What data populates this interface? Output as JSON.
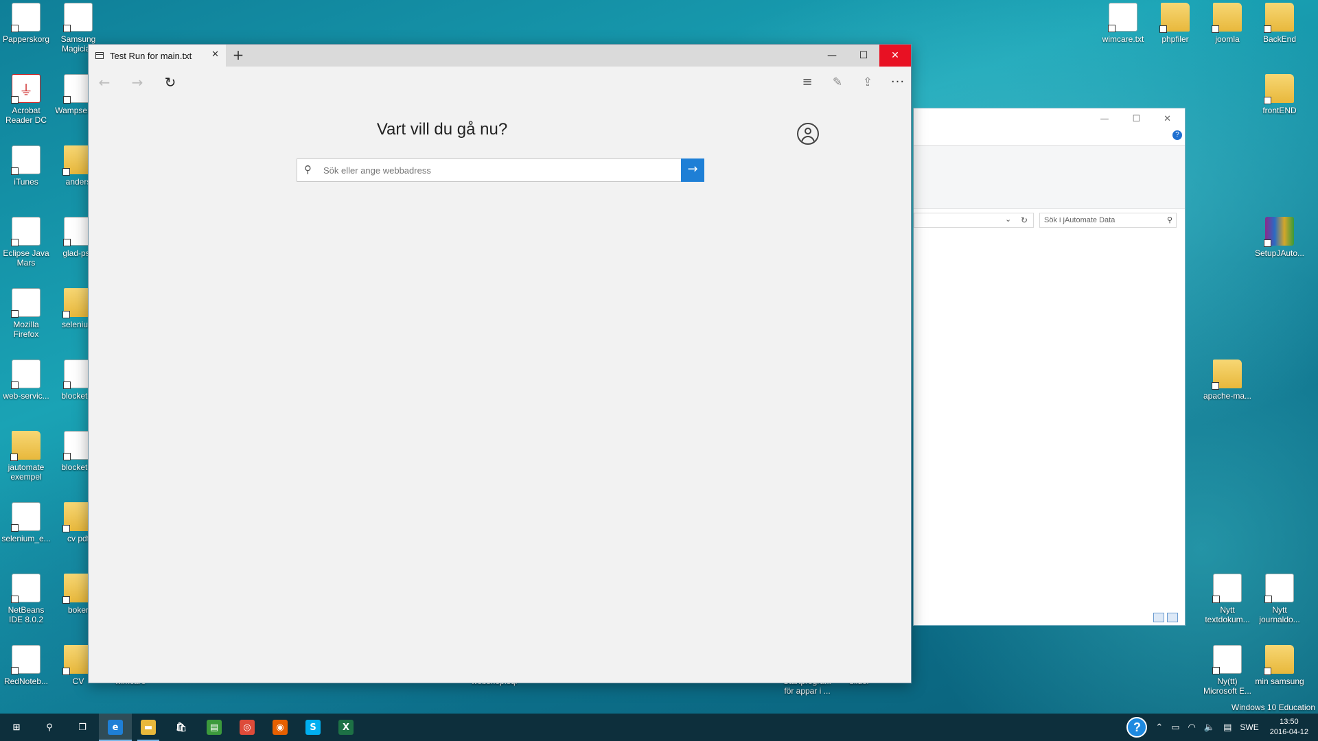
{
  "desktop": {
    "icons": [
      {
        "label": "Papperskorg",
        "glyph": "🗑",
        "kind": "doc"
      },
      {
        "label": "Samsung Magician",
        "glyph": "▦",
        "kind": "doc"
      },
      {
        "label": "Acrobat Reader DC",
        "glyph": "⏚",
        "kind": "pdf"
      },
      {
        "label": "Wampserver",
        "glyph": "W",
        "kind": "doc"
      },
      {
        "label": "iTunes",
        "glyph": "♫",
        "kind": "doc"
      },
      {
        "label": "anders",
        "glyph": "",
        "kind": "folder"
      },
      {
        "label": "Eclipse Java Mars",
        "glyph": "◐",
        "kind": "doc"
      },
      {
        "label": "glad-psk",
        "glyph": "✿",
        "kind": "doc"
      },
      {
        "label": "Mozilla Firefox",
        "glyph": "◉",
        "kind": "doc"
      },
      {
        "label": "selenium",
        "glyph": "",
        "kind": "folder"
      },
      {
        "label": "web-servic...",
        "glyph": "W",
        "kind": "doc"
      },
      {
        "label": "blocket-T",
        "glyph": "◉",
        "kind": "doc"
      },
      {
        "label": "jautomate exempel",
        "glyph": "",
        "kind": "folder"
      },
      {
        "label": "blocket-T",
        "glyph": "e",
        "kind": "doc"
      },
      {
        "label": "selenium_e...",
        "glyph": "◉",
        "kind": "doc"
      },
      {
        "label": "cv pdf",
        "glyph": "",
        "kind": "folder"
      },
      {
        "label": "NetBeans IDE 8.0.2",
        "glyph": "◆",
        "kind": "doc"
      },
      {
        "label": "boker",
        "glyph": "",
        "kind": "folder"
      },
      {
        "label": "RedNoteb...",
        "glyph": "✎",
        "kind": "doc"
      },
      {
        "label": "CV",
        "glyph": "",
        "kind": "folder"
      },
      {
        "label": "wimcare",
        "glyph": "",
        "kind": "folder"
      },
      {
        "label": "webshop.sql",
        "glyph": "",
        "kind": "doc"
      },
      {
        "label": "Startprogra... för appar i ...",
        "glyph": "",
        "kind": "folder"
      },
      {
        "label": "bilder",
        "glyph": "",
        "kind": "folder"
      },
      {
        "label": "wimcare.txt",
        "glyph": "",
        "kind": "doc"
      },
      {
        "label": "phpfiler",
        "glyph": "",
        "kind": "folder"
      },
      {
        "label": "joomla",
        "glyph": "",
        "kind": "folder"
      },
      {
        "label": "BackEnd",
        "glyph": "",
        "kind": "folder"
      },
      {
        "label": "frontEND",
        "glyph": "",
        "kind": "folder"
      },
      {
        "label": "SetupJAuto...",
        "glyph": "",
        "kind": "zip"
      },
      {
        "label": "apache-ma...",
        "glyph": "",
        "kind": "folder"
      },
      {
        "label": "Nytt textdokum...",
        "glyph": "",
        "kind": "doc"
      },
      {
        "label": "Nytt journaldo...",
        "glyph": "✎",
        "kind": "doc"
      },
      {
        "label": "Ny(tt) Microsoft E...",
        "glyph": "X",
        "kind": "doc"
      },
      {
        "label": "min samsung",
        "glyph": "",
        "kind": "folder"
      }
    ],
    "watermark": "Windows 10 Education"
  },
  "explorer": {
    "search_placeholder": "Sök i jAutomate Data",
    "help_label": "?"
  },
  "edge": {
    "tab_title": "Test Run for main.txt",
    "tab_close": "✕",
    "new_tab": "+",
    "min": "—",
    "max": "☐",
    "close": "✕",
    "nav": {
      "back": "←",
      "forward": "→",
      "refresh": "↻",
      "hub": "≡",
      "note": "✎",
      "share": "⇪",
      "more": "···"
    },
    "heading": "Vart vill du gå nu?",
    "search_placeholder": "Sök eller ange webbadress",
    "search_icon": "⚲",
    "go": "→"
  },
  "taskbar": {
    "apps": [
      {
        "name": "start-button",
        "glyph": "⊞",
        "state": ""
      },
      {
        "name": "search-button",
        "glyph": "⚲",
        "state": ""
      },
      {
        "name": "task-view-button",
        "glyph": "❐",
        "state": ""
      },
      {
        "name": "edge-taskbar-button",
        "glyph": "e",
        "state": "active"
      },
      {
        "name": "file-explorer-taskbar-button",
        "glyph": "▬",
        "state": "open"
      },
      {
        "name": "store-taskbar-button",
        "glyph": "🛍",
        "state": ""
      },
      {
        "name": "notepad-taskbar-button",
        "glyph": "▤",
        "state": ""
      },
      {
        "name": "chrome-taskbar-button",
        "glyph": "◎",
        "state": ""
      },
      {
        "name": "firefox-taskbar-button",
        "glyph": "◉",
        "state": ""
      },
      {
        "name": "skype-taskbar-button",
        "glyph": "S",
        "state": ""
      },
      {
        "name": "excel-taskbar-button",
        "glyph": "X",
        "state": ""
      }
    ],
    "tray": {
      "help": "?",
      "language": "SWE",
      "time": "13:50",
      "date": "2016-04-12"
    }
  },
  "colors": {
    "accent": "#1e7fd6",
    "close_red": "#e81123",
    "taskbar": "#0d2f3c"
  }
}
